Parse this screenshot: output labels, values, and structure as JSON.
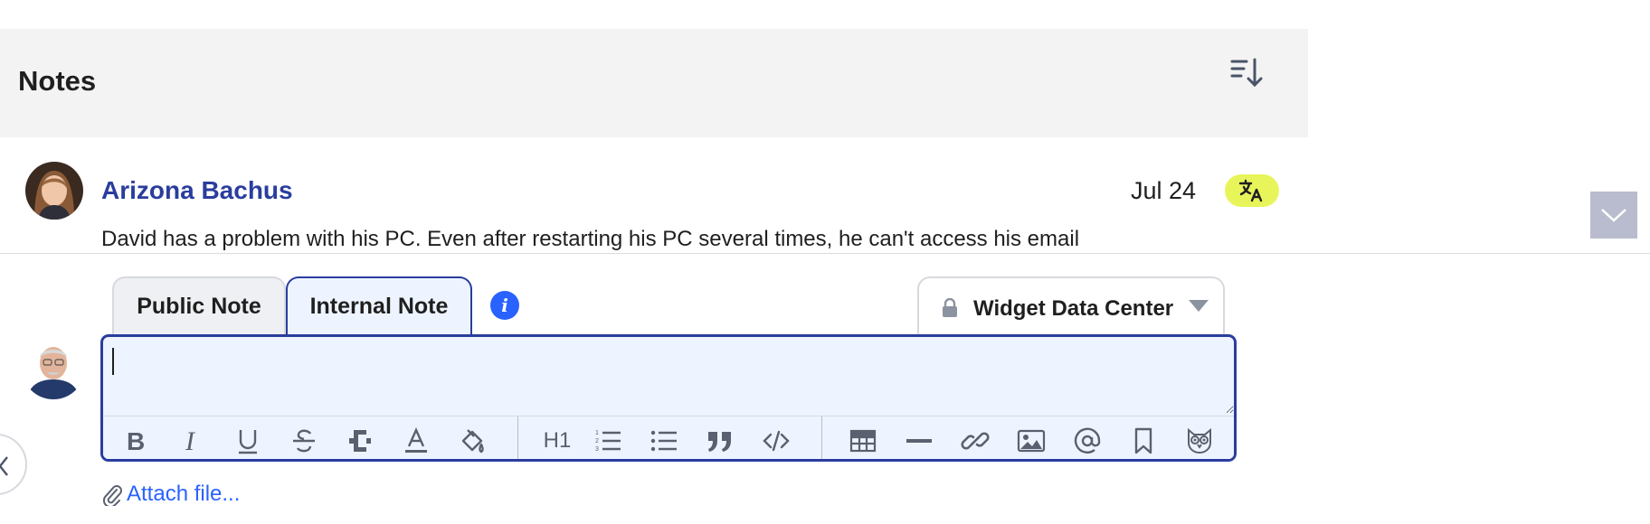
{
  "header": {
    "title": "Notes",
    "sort_icon": "sort-descending-icon"
  },
  "note": {
    "author": "Arizona Bachus",
    "date": "Jul 24",
    "translate_icon": "translate-icon",
    "text": "David has a problem with his PC. Even after restarting his PC several times, he can't access his email"
  },
  "composer": {
    "tabs": [
      {
        "label": "Public Note",
        "active": false
      },
      {
        "label": "Internal Note",
        "active": true
      }
    ],
    "info_icon_glyph": "i",
    "visibility": {
      "label": "Widget Data Center",
      "icon": "lock-icon"
    },
    "input_value": "",
    "toolbar": {
      "heading_label": "H1",
      "buttons": [
        "bold",
        "italic",
        "underline",
        "strikethrough",
        "clear-format",
        "text-color",
        "highlight",
        "heading",
        "ordered-list",
        "bullet-list",
        "quote",
        "code",
        "table",
        "horizontal-rule",
        "link",
        "image",
        "mention",
        "bookmark",
        "owl"
      ]
    },
    "attach_label": "Attach file..."
  },
  "colors": {
    "accent": "#2a3d9e",
    "link": "#2962ff",
    "badge": "#e8f55a",
    "header_bg": "#f3f3f3",
    "editor_bg": "#eef4ff"
  }
}
